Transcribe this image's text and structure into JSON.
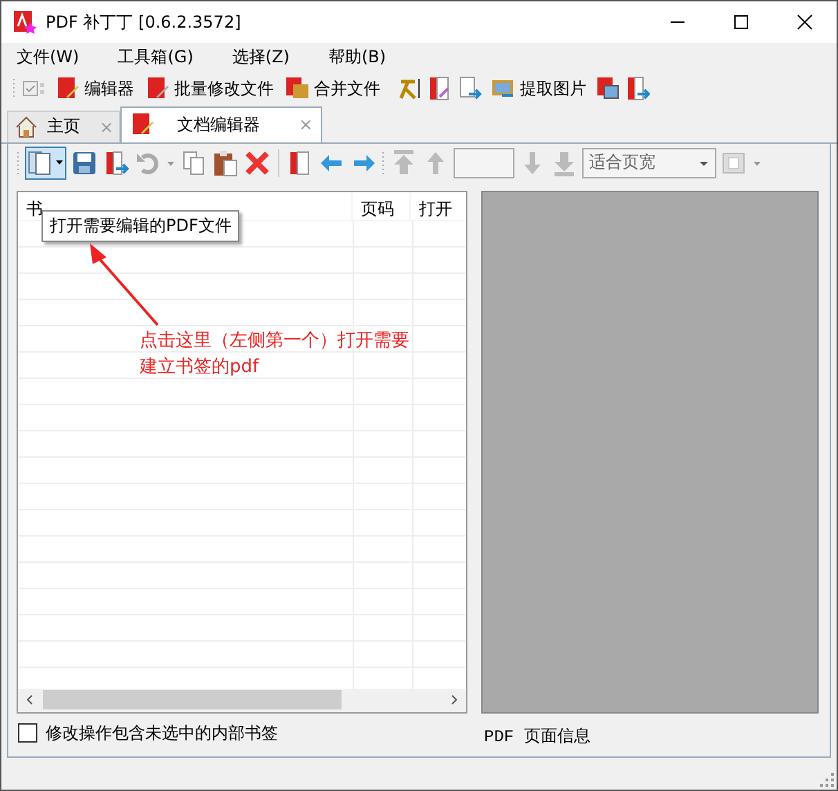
{
  "window": {
    "title": "PDF 补丁丁 [0.6.2.3572]"
  },
  "menu": [
    "文件(W)",
    "工具箱(G)",
    "选择(Z)",
    "帮助(B)"
  ],
  "toolbar": [
    {
      "label": "编辑器"
    },
    {
      "label": "批量修改文件"
    },
    {
      "label": "合并文件"
    },
    {
      "label": "提取图片"
    }
  ],
  "tabs": [
    {
      "label": "主页",
      "close": "×",
      "selected": false
    },
    {
      "label": "文档编辑器",
      "close": "×",
      "selected": true
    }
  ],
  "editor_toolbar": {
    "zoom": "适合页宽"
  },
  "tooltip": "打开需要编辑的PDF文件",
  "table": {
    "columns": [
      "书",
      "页码",
      "打开"
    ]
  },
  "annotation": [
    "点击这里（左侧第一个）打开需要",
    "建立书签的pdf"
  ],
  "option": {
    "label": "修改操作包含未选中的内部书签",
    "checked": false
  },
  "preview": {
    "info": "PDF 页面信息"
  }
}
